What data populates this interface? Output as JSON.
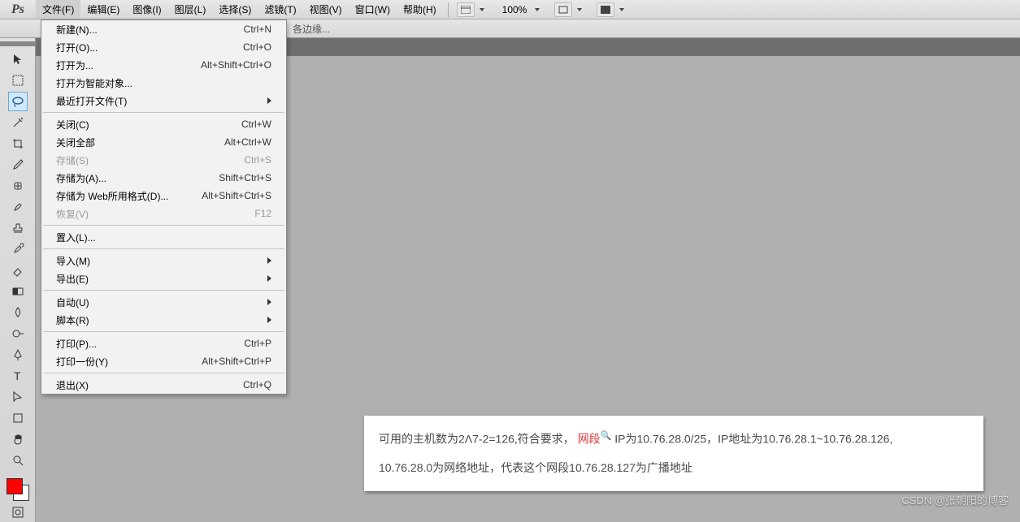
{
  "app": {
    "logo": "Ps",
    "zoom": "100%"
  },
  "menus": {
    "file": "文件(F)",
    "edit": "编辑(E)",
    "image": "图像(I)",
    "layer": "图层(L)",
    "select": "选择(S)",
    "filter": "滤镜(T)",
    "view": "视图(V)",
    "window": "窗口(W)",
    "help": "帮助(H)"
  },
  "optionsbar": {
    "edge_text": "各边缘..."
  },
  "file_menu": {
    "new": {
      "label": "新建(N)...",
      "shortcut": "Ctrl+N"
    },
    "open": {
      "label": "打开(O)...",
      "shortcut": "Ctrl+O"
    },
    "browse": {
      "label": "打开为...",
      "shortcut": "Alt+Shift+Ctrl+O"
    },
    "open_smart": {
      "label": "打开为智能对象..."
    },
    "recent": {
      "label": "最近打开文件(T)"
    },
    "close": {
      "label": "关闭(C)",
      "shortcut": "Ctrl+W"
    },
    "close_all": {
      "label": "关闭全部",
      "shortcut": "Alt+Ctrl+W"
    },
    "save": {
      "label": "存储(S)",
      "shortcut": "Ctrl+S"
    },
    "save_as": {
      "label": "存储为(A)...",
      "shortcut": "Shift+Ctrl+S"
    },
    "save_web": {
      "label": "存储为 Web所用格式(D)...",
      "shortcut": "Alt+Shift+Ctrl+S"
    },
    "revert": {
      "label": "恢复(V)",
      "shortcut": "F12"
    },
    "place": {
      "label": "置入(L)..."
    },
    "import": {
      "label": "导入(M)"
    },
    "export": {
      "label": "导出(E)"
    },
    "automate": {
      "label": "自动(U)"
    },
    "scripts": {
      "label": "脚本(R)"
    },
    "print": {
      "label": "打印(P)...",
      "shortcut": "Ctrl+P"
    },
    "print_one": {
      "label": "打印一份(Y)",
      "shortcut": "Alt+Shift+Ctrl+P"
    },
    "exit": {
      "label": "退出(X)",
      "shortcut": "Ctrl+Q"
    }
  },
  "textbox": {
    "line1a": "可用的主机数为2Λ7-2=126,符合要求，",
    "line1_hl": "网段",
    "line1b": "IP为10.76.28.0/25，IP地址为10.76.28.1~10.76.28.126,",
    "line2": "10.76.28.0为网络地址，代表这个网段10.76.28.127为广播地址"
  },
  "watermark": "CSDN @张朝阳的博客"
}
